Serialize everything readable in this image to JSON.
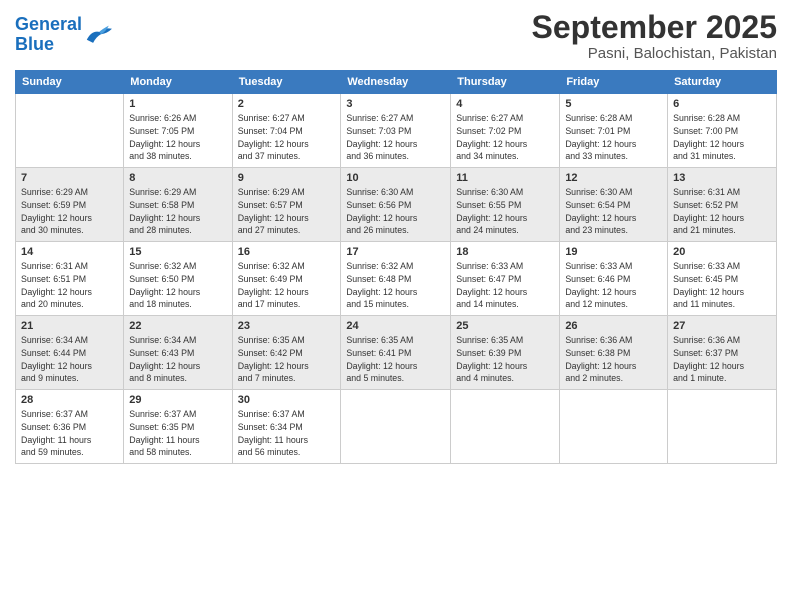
{
  "header": {
    "logo_line1": "General",
    "logo_line2": "Blue",
    "month": "September 2025",
    "location": "Pasni, Balochistan, Pakistan"
  },
  "weekdays": [
    "Sunday",
    "Monday",
    "Tuesday",
    "Wednesday",
    "Thursday",
    "Friday",
    "Saturday"
  ],
  "weeks": [
    [
      {
        "day": "",
        "info": ""
      },
      {
        "day": "1",
        "info": "Sunrise: 6:26 AM\nSunset: 7:05 PM\nDaylight: 12 hours\nand 38 minutes."
      },
      {
        "day": "2",
        "info": "Sunrise: 6:27 AM\nSunset: 7:04 PM\nDaylight: 12 hours\nand 37 minutes."
      },
      {
        "day": "3",
        "info": "Sunrise: 6:27 AM\nSunset: 7:03 PM\nDaylight: 12 hours\nand 36 minutes."
      },
      {
        "day": "4",
        "info": "Sunrise: 6:27 AM\nSunset: 7:02 PM\nDaylight: 12 hours\nand 34 minutes."
      },
      {
        "day": "5",
        "info": "Sunrise: 6:28 AM\nSunset: 7:01 PM\nDaylight: 12 hours\nand 33 minutes."
      },
      {
        "day": "6",
        "info": "Sunrise: 6:28 AM\nSunset: 7:00 PM\nDaylight: 12 hours\nand 31 minutes."
      }
    ],
    [
      {
        "day": "7",
        "info": "Sunrise: 6:29 AM\nSunset: 6:59 PM\nDaylight: 12 hours\nand 30 minutes."
      },
      {
        "day": "8",
        "info": "Sunrise: 6:29 AM\nSunset: 6:58 PM\nDaylight: 12 hours\nand 28 minutes."
      },
      {
        "day": "9",
        "info": "Sunrise: 6:29 AM\nSunset: 6:57 PM\nDaylight: 12 hours\nand 27 minutes."
      },
      {
        "day": "10",
        "info": "Sunrise: 6:30 AM\nSunset: 6:56 PM\nDaylight: 12 hours\nand 26 minutes."
      },
      {
        "day": "11",
        "info": "Sunrise: 6:30 AM\nSunset: 6:55 PM\nDaylight: 12 hours\nand 24 minutes."
      },
      {
        "day": "12",
        "info": "Sunrise: 6:30 AM\nSunset: 6:54 PM\nDaylight: 12 hours\nand 23 minutes."
      },
      {
        "day": "13",
        "info": "Sunrise: 6:31 AM\nSunset: 6:52 PM\nDaylight: 12 hours\nand 21 minutes."
      }
    ],
    [
      {
        "day": "14",
        "info": "Sunrise: 6:31 AM\nSunset: 6:51 PM\nDaylight: 12 hours\nand 20 minutes."
      },
      {
        "day": "15",
        "info": "Sunrise: 6:32 AM\nSunset: 6:50 PM\nDaylight: 12 hours\nand 18 minutes."
      },
      {
        "day": "16",
        "info": "Sunrise: 6:32 AM\nSunset: 6:49 PM\nDaylight: 12 hours\nand 17 minutes."
      },
      {
        "day": "17",
        "info": "Sunrise: 6:32 AM\nSunset: 6:48 PM\nDaylight: 12 hours\nand 15 minutes."
      },
      {
        "day": "18",
        "info": "Sunrise: 6:33 AM\nSunset: 6:47 PM\nDaylight: 12 hours\nand 14 minutes."
      },
      {
        "day": "19",
        "info": "Sunrise: 6:33 AM\nSunset: 6:46 PM\nDaylight: 12 hours\nand 12 minutes."
      },
      {
        "day": "20",
        "info": "Sunrise: 6:33 AM\nSunset: 6:45 PM\nDaylight: 12 hours\nand 11 minutes."
      }
    ],
    [
      {
        "day": "21",
        "info": "Sunrise: 6:34 AM\nSunset: 6:44 PM\nDaylight: 12 hours\nand 9 minutes."
      },
      {
        "day": "22",
        "info": "Sunrise: 6:34 AM\nSunset: 6:43 PM\nDaylight: 12 hours\nand 8 minutes."
      },
      {
        "day": "23",
        "info": "Sunrise: 6:35 AM\nSunset: 6:42 PM\nDaylight: 12 hours\nand 7 minutes."
      },
      {
        "day": "24",
        "info": "Sunrise: 6:35 AM\nSunset: 6:41 PM\nDaylight: 12 hours\nand 5 minutes."
      },
      {
        "day": "25",
        "info": "Sunrise: 6:35 AM\nSunset: 6:39 PM\nDaylight: 12 hours\nand 4 minutes."
      },
      {
        "day": "26",
        "info": "Sunrise: 6:36 AM\nSunset: 6:38 PM\nDaylight: 12 hours\nand 2 minutes."
      },
      {
        "day": "27",
        "info": "Sunrise: 6:36 AM\nSunset: 6:37 PM\nDaylight: 12 hours\nand 1 minute."
      }
    ],
    [
      {
        "day": "28",
        "info": "Sunrise: 6:37 AM\nSunset: 6:36 PM\nDaylight: 11 hours\nand 59 minutes."
      },
      {
        "day": "29",
        "info": "Sunrise: 6:37 AM\nSunset: 6:35 PM\nDaylight: 11 hours\nand 58 minutes."
      },
      {
        "day": "30",
        "info": "Sunrise: 6:37 AM\nSunset: 6:34 PM\nDaylight: 11 hours\nand 56 minutes."
      },
      {
        "day": "",
        "info": ""
      },
      {
        "day": "",
        "info": ""
      },
      {
        "day": "",
        "info": ""
      },
      {
        "day": "",
        "info": ""
      }
    ]
  ]
}
